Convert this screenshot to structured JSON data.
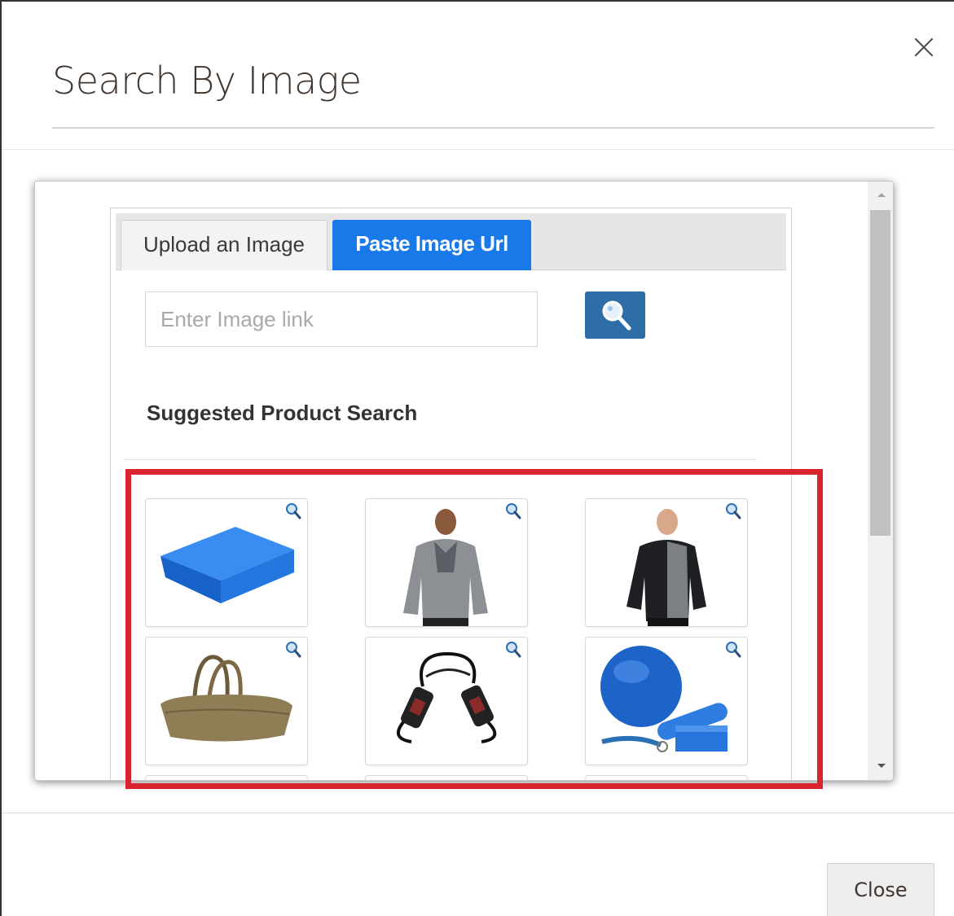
{
  "modal": {
    "title": "Search By Image",
    "close_button_label": "Close"
  },
  "tabs": [
    {
      "label": "Upload an Image",
      "active": false
    },
    {
      "label": "Paste Image Url",
      "active": true
    }
  ],
  "url_input": {
    "placeholder": "Enter Image link",
    "value": ""
  },
  "suggested": {
    "title": "Suggested Product Search",
    "products": [
      {
        "icon": "foam-block-image"
      },
      {
        "icon": "gray-hoodie-man-image"
      },
      {
        "icon": "black-jacket-man-image"
      },
      {
        "icon": "canvas-duffel-bag-image"
      },
      {
        "icon": "resistance-band-image"
      },
      {
        "icon": "exercise-ball-kit-image"
      }
    ]
  },
  "colors": {
    "active_tab": "#1979e8",
    "search_button": "#2e6da8",
    "highlight": "#d9232e"
  }
}
